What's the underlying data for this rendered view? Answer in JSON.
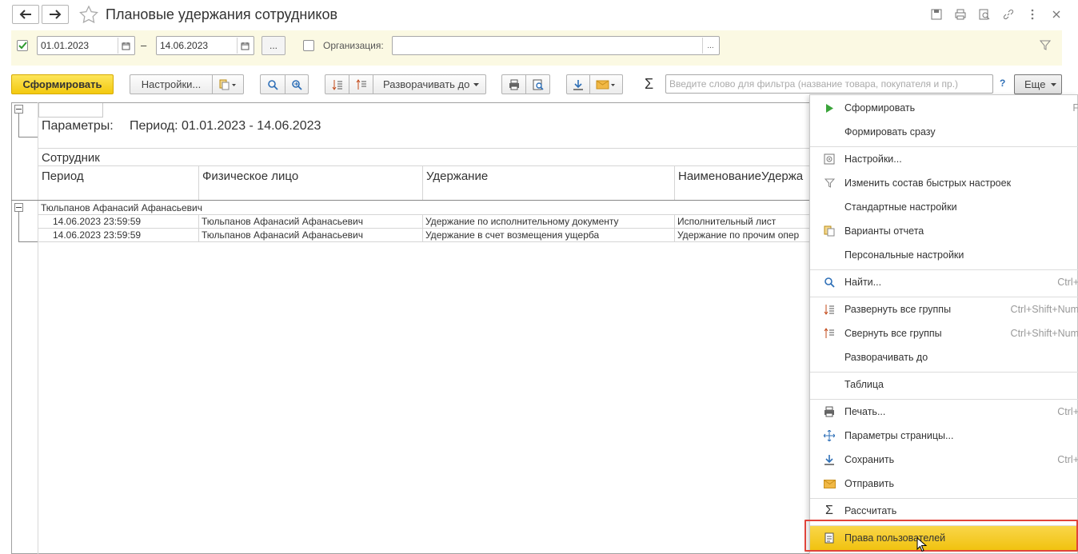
{
  "window": {
    "title": "Плановые удержания сотрудников"
  },
  "filter": {
    "period_checked": true,
    "date_from": "01.01.2023",
    "date_separator": "–",
    "date_to": "14.06.2023",
    "choose_period_label": "...",
    "org_checked": false,
    "org_label": "Организация:",
    "org_value": "",
    "org_select_label": "..."
  },
  "toolbar": {
    "generate_label": "Сформировать",
    "settings_label": "Настройки...",
    "expand_to_label": "Разворачивать до",
    "search_placeholder": "Введите слово для фильтра (название товара, покупателя и пр.)",
    "help_label": "?",
    "more_label": "Еще"
  },
  "report": {
    "params_label": "Параметры:",
    "params_value": "Период: 01.01.2023 - 14.06.2023",
    "group_header": "Сотрудник",
    "columns": [
      "Период",
      "Физическое лицо",
      "Удержание",
      "НаименованиеУдержа"
    ],
    "group_name": "Тюльпанов Афанасий Афанасьевич",
    "rows": [
      [
        "14.06.2023 23:59:59",
        "Тюльпанов Афанасий Афанасьевич",
        "Удержание по исполнительному документу",
        "Исполнительный лист"
      ],
      [
        "14.06.2023 23:59:59",
        "Тюльпанов Афанасий Афанасьевич",
        "Удержание в счет возмещения ущерба",
        "Удержание по прочим опер"
      ]
    ]
  },
  "menu": {
    "items": [
      {
        "label": "Сформировать",
        "shortcut": "F",
        "icon": "play-icon"
      },
      {
        "label": "Формировать сразу",
        "shortcut": "",
        "icon": ""
      },
      {
        "label": "Настройки...",
        "shortcut": "",
        "icon": "settings-icon"
      },
      {
        "label": "Изменить состав быстрых настроек",
        "shortcut": "",
        "icon": "filter-icon"
      },
      {
        "label": "Стандартные настройки",
        "shortcut": "",
        "icon": ""
      },
      {
        "label": "Варианты отчета",
        "shortcut": "",
        "icon": "variants-icon"
      },
      {
        "label": "Персональные настройки",
        "shortcut": "",
        "icon": ""
      },
      {
        "label": "Найти...",
        "shortcut": "Ctrl+",
        "icon": "search-icon"
      },
      {
        "label": "Развернуть все группы",
        "shortcut": "Ctrl+Shift+Num",
        "icon": "expand-all-icon"
      },
      {
        "label": "Свернуть все группы",
        "shortcut": "Ctrl+Shift+Num",
        "icon": "collapse-all-icon"
      },
      {
        "label": "Разворачивать до",
        "shortcut": "",
        "icon": ""
      },
      {
        "label": "Таблица",
        "shortcut": "",
        "icon": ""
      },
      {
        "label": "Печать...",
        "shortcut": "Ctrl+",
        "icon": "print-icon"
      },
      {
        "label": "Параметры страницы...",
        "shortcut": "",
        "icon": "page-setup-icon"
      },
      {
        "label": "Сохранить",
        "shortcut": "Ctrl+",
        "icon": "save-icon"
      },
      {
        "label": "Отправить",
        "shortcut": "",
        "icon": "mail-icon"
      },
      {
        "label": "Рассчитать",
        "shortcut": "",
        "icon": "sum-icon"
      },
      {
        "label": "Права пользователей",
        "shortcut": "",
        "icon": "user-rights-icon"
      }
    ]
  },
  "colors": {
    "accent_yellow": "#f3c90e",
    "filter_bg": "#fbf9e3",
    "highlight_frame": "#e0443b"
  }
}
